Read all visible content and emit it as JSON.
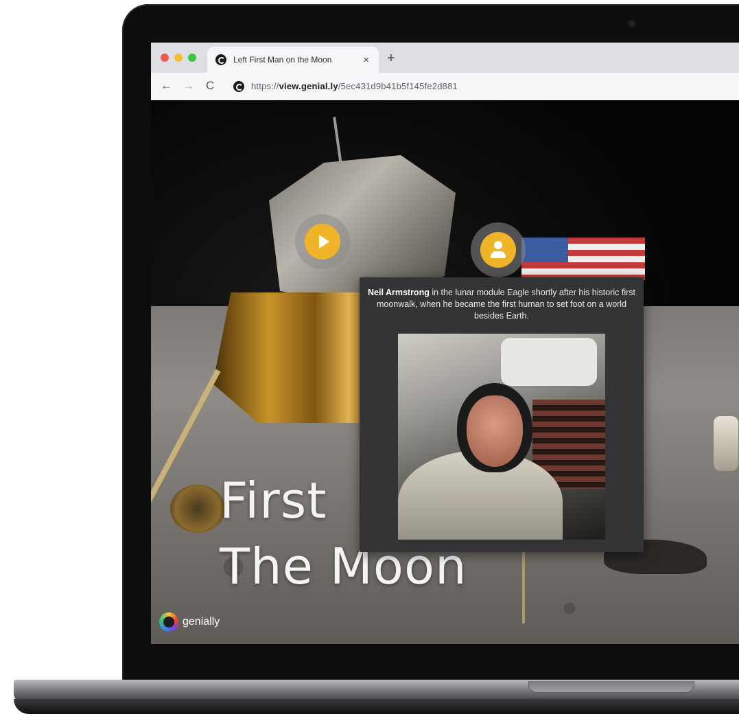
{
  "browser": {
    "tab_title": "Left First Man on the Moon",
    "tab_close": "×",
    "new_tab": "+",
    "nav_back": "←",
    "nav_forward": "→",
    "nav_reload": "C",
    "url_scheme": "https://",
    "url_domain": "view.genial.ly",
    "url_path": "/5ec431d9b41b5f145fe2d881"
  },
  "page": {
    "title_line1": "First",
    "title_line2": "The Moon",
    "popup_bold": "Neil Armstrong",
    "popup_text": " in the lunar module Eagle shortly after his historic first moonwalk, when he became the first human to set foot on a world besides Earth.",
    "logo_text": "genially"
  },
  "icons": {
    "play": "play-icon",
    "person": "person-icon"
  },
  "colors": {
    "accent": "#f0b429",
    "popup_bg": "#333435"
  }
}
